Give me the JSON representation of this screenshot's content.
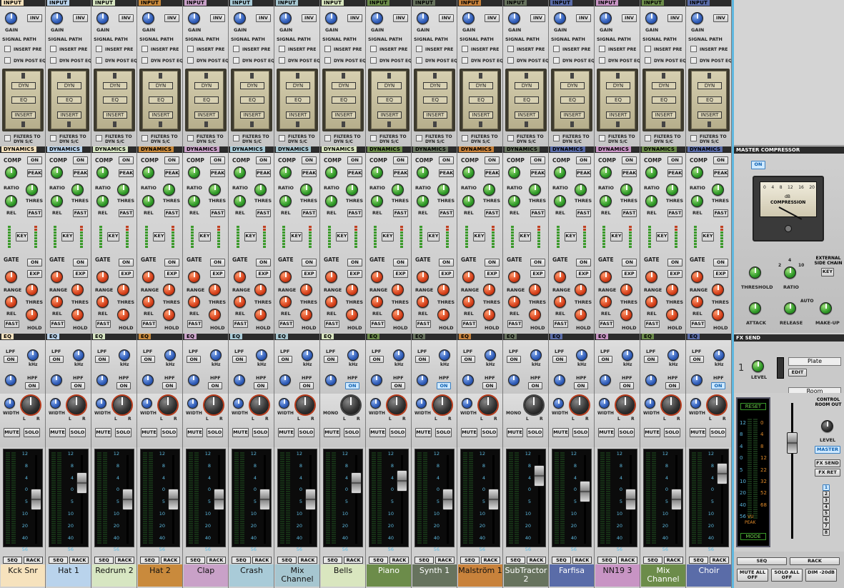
{
  "section_labels": {
    "input": "INPUT",
    "dynamics": "DYNAMICS",
    "eq": "EQ"
  },
  "strip_common": {
    "gain": "GAIN",
    "inv": "INV",
    "signal_path": "SIGNAL PATH",
    "insert_pre": "INSERT PRE",
    "dyn_post_eq": "DYN POST EQ",
    "dyn": "DYN",
    "eq": "EQ",
    "insert": "INSERT",
    "filters_to": "FILTERS TO",
    "dyn_sc": "DYN S/C",
    "comp": "COMP",
    "on": "ON",
    "peak": "PEAK",
    "ratio": "RATIO",
    "thres": "THRES",
    "rel": "REL",
    "fast": "FAST",
    "key": "KEY",
    "gate": "GATE",
    "exp": "EXP",
    "range": "RANGE",
    "hold": "HOLD",
    "lpf": "LPF",
    "hpf": "HPF",
    "khz": "kHz",
    "hz": "Hz",
    "width": "WIDTH",
    "mono": "MONO",
    "l": "L",
    "r": "R",
    "mute": "MUTE",
    "solo": "SOLO",
    "seq": "SEQ",
    "rack": "RACK",
    "meter_scale": [
      "12",
      "8",
      "4",
      "0",
      "5",
      "10",
      "20",
      "40",
      "56"
    ]
  },
  "channels": [
    {
      "name": "Kck Snr",
      "color": "#f6e2bd",
      "mode": "WIDTH",
      "fader": 0.5
    },
    {
      "name": "Hat 1",
      "color": "#b9d3ec",
      "mode": "WIDTH",
      "fader": 0.75
    },
    {
      "name": "Redrum 2",
      "color": "#d7e6c2",
      "mode": "WIDTH",
      "fader": 0.5
    },
    {
      "name": "Hat 2",
      "color": "#c98a3c",
      "mode": "WIDTH",
      "fader": 0.5
    },
    {
      "name": "Clap",
      "color": "#c9a1c8",
      "mode": "WIDTH",
      "fader": 0.5
    },
    {
      "name": "Crash",
      "color": "#a9cbd8",
      "mode": "WIDTH",
      "fader": 0.5
    },
    {
      "name": "Mix Channel",
      "color": "#a6c6d0",
      "mode": "WIDTH",
      "fader": 0.5
    },
    {
      "name": "Bells",
      "color": "#d9e6bf",
      "mode": "MONO",
      "fader": 0.75
    },
    {
      "name": "Piano",
      "color": "#6c8c4a",
      "mode": "WIDTH",
      "fader": 0.78
    },
    {
      "name": "Synth 1",
      "color": "#67735e",
      "mode": "WIDTH",
      "fader": 0.5
    },
    {
      "name": "Malström 1",
      "color": "#c8823b",
      "mode": "WIDTH",
      "fader": 0.5
    },
    {
      "name": "SubTractor 2",
      "color": "#67735e",
      "mode": "MONO",
      "fader": 0.85
    },
    {
      "name": "Farfisa",
      "color": "#5a6ca8",
      "mode": "WIDTH",
      "fader": 0.62
    },
    {
      "name": "NN19 3",
      "color": "#c894c4",
      "mode": "WIDTH",
      "fader": 0.5
    },
    {
      "name": "Mix Channel",
      "color": "#6c8c4a",
      "mode": "WIDTH",
      "fader": 0.5
    },
    {
      "name": "Choir",
      "color": "#5a6ca8",
      "mode": "WIDTH",
      "fader": 0.88
    }
  ],
  "master": {
    "compressor_title": "MASTER COMPRESSOR",
    "on": "ON",
    "vu_scale": [
      "0",
      "4",
      "8",
      "12",
      "16",
      "20"
    ],
    "db": "dB",
    "compression": "COMPRESSION",
    "threshold": "THRESHOLD",
    "ratio": "RATIO",
    "ratio_marks": [
      "2",
      "4",
      "10"
    ],
    "external_side_chain": "EXTERNAL SIDE CHAIN",
    "key": "KEY",
    "attack": "ATTACK",
    "release": "RELEASE",
    "auto": "AUTO",
    "make_up": "MAKE-UP",
    "fx_send_title": "FX SEND",
    "fx_sends": [
      {
        "num": "1",
        "level": "LEVEL",
        "name": "Plate",
        "edit": "EDIT"
      },
      {
        "num": "2",
        "name": "Room"
      }
    ],
    "reset": "RESET",
    "mode": "MODE",
    "vu_label": "VU",
    "peak_label": "PEAK",
    "scale_left": [
      "12",
      "8",
      "4",
      "0",
      "5",
      "10",
      "20",
      "40",
      "56"
    ],
    "scale_right": [
      "0",
      "4",
      "8",
      "12",
      "22",
      "32",
      "52",
      "68"
    ],
    "control_room_out": "CONTROL ROOM OUT",
    "level": "LEVEL",
    "master_btn": "MASTER",
    "fx_send_btn": "FX SEND",
    "fx_ret_btn": "FX RET",
    "sends": [
      "1",
      "2",
      "3",
      "4",
      "5",
      "6",
      "7",
      "8"
    ],
    "seq": "SEQ",
    "rack": "RACK",
    "mute_all_off": "MUTE ALL OFF",
    "solo_all_off": "SOLO ALL OFF",
    "dim": "DIM -20dB"
  }
}
